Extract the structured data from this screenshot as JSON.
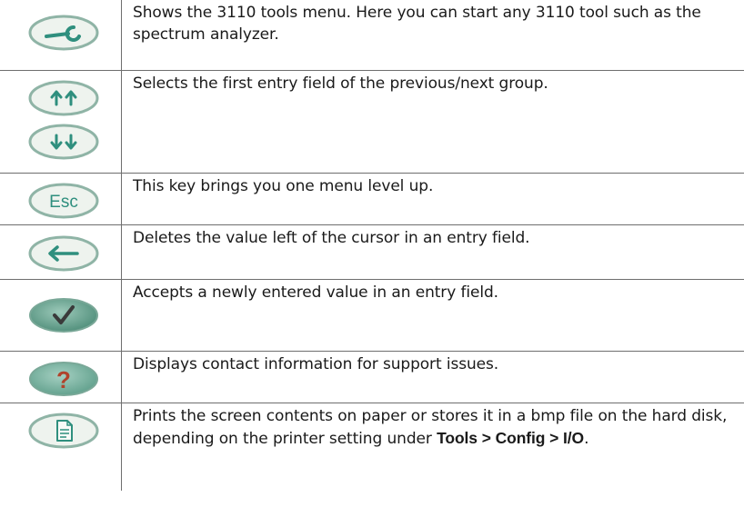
{
  "rows": [
    {
      "icon": "wrench-key-icon",
      "description": "Shows the 3110 tools menu. Here you can start any 3110 tool such as the spectrum analyzer."
    },
    {
      "icon": "up-down-double-arrow-keys-icon",
      "description": "Selects the first entry field of the previous/next group."
    },
    {
      "icon": "esc-key-icon",
      "key_label": "Esc",
      "description": "This key brings you one menu level up."
    },
    {
      "icon": "backspace-arrow-key-icon",
      "description": "Deletes the value left of the cursor in an entry field."
    },
    {
      "icon": "checkmark-key-icon",
      "description": "Accepts a newly entered value in an entry field."
    },
    {
      "icon": "question-mark-key-icon",
      "key_label": "?",
      "description": "Displays contact information for support issues."
    },
    {
      "icon": "print-document-key-icon",
      "description_before": "Prints the screen contents on paper or stores it in a bmp file on the hard disk, depending on the printer setting under ",
      "description_bold": "Tools > Config > I/O",
      "description_after": "."
    }
  ],
  "colors": {
    "key_face_light": "#eef3ee",
    "key_rim": "#8fb4a6",
    "key_symbol": "#2f8f7e",
    "key_face_green": "#5e9e8a"
  }
}
